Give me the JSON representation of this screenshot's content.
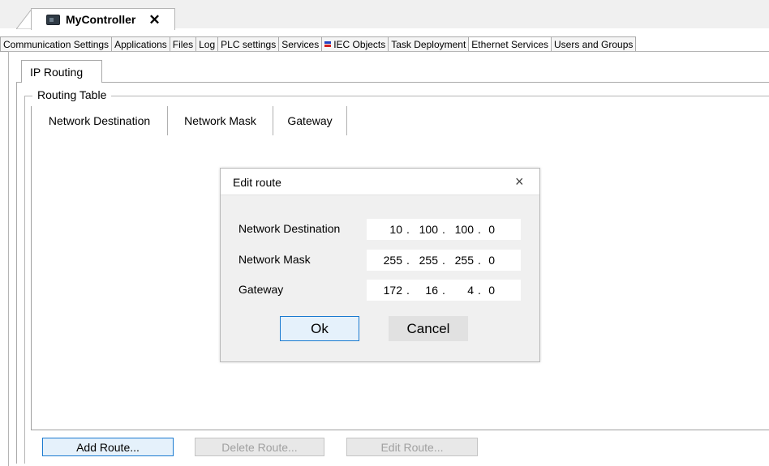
{
  "editor_tab": {
    "title": "MyController",
    "close_glyph": "✕",
    "icon": "controller-icon"
  },
  "main_tabs": [
    {
      "label": "Communication Settings",
      "active": false
    },
    {
      "label": "Applications",
      "active": false
    },
    {
      "label": "Files",
      "active": false
    },
    {
      "label": "Log",
      "active": false
    },
    {
      "label": "PLC settings",
      "active": false
    },
    {
      "label": "Services",
      "active": false
    },
    {
      "label": "IEC Objects",
      "active": false,
      "icon": "iec-objects-icon"
    },
    {
      "label": "Task Deployment",
      "active": false
    },
    {
      "label": "Ethernet Services",
      "active": true
    },
    {
      "label": "Users and Groups",
      "active": false
    }
  ],
  "sub_tab": {
    "label": "IP Routing"
  },
  "routing_table": {
    "group_title": "Routing Table",
    "columns": [
      "Network Destination",
      "Network Mask",
      "Gateway"
    ],
    "rows": []
  },
  "buttons": {
    "add_route": "Add Route...",
    "delete_route": "Delete Route...",
    "edit_route": "Edit Route..."
  },
  "dialog": {
    "title": "Edit route",
    "close_glyph": "×",
    "fields": [
      {
        "label": "Network Destination",
        "octets": [
          "10",
          "100",
          "100",
          "0"
        ]
      },
      {
        "label": "Network Mask",
        "octets": [
          "255",
          "255",
          "255",
          "0"
        ]
      },
      {
        "label": "Gateway",
        "octets": [
          "172",
          "16",
          "4",
          "0"
        ]
      }
    ],
    "ok_label": "Ok",
    "cancel_label": "Cancel"
  },
  "colors": {
    "accent_border": "#1a7ad0",
    "disabled_text": "#a0a0a0"
  }
}
